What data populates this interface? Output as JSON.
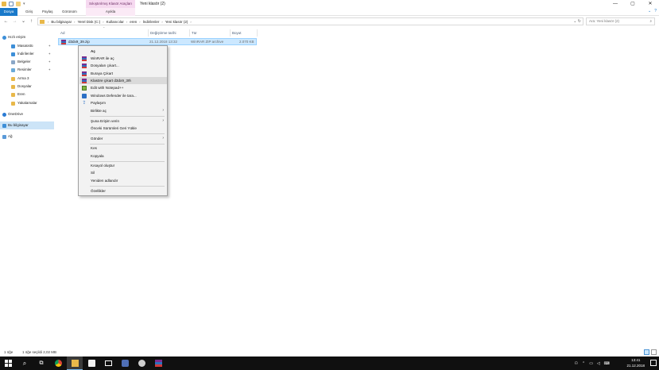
{
  "window": {
    "title": "Yeni klasör (2)",
    "context_tab_header": "Sıkıştırılmış Klasör Araçları",
    "controls": [
      "—",
      "▢",
      "✕"
    ]
  },
  "ribbon": {
    "tabs": [
      "Dosya",
      "Giriş",
      "Paylaş",
      "Görünüm",
      "Ayıkla"
    ]
  },
  "address": {
    "crumbs": [
      "Bu bilgisayar",
      "Yerel Disk (C:)",
      "Kullanıcılar",
      "eren",
      "İndirilenler",
      "Yeni klasör (2)"
    ],
    "search_placeholder": "Ara: Yeni klasör (2)"
  },
  "nav": {
    "quick_access": "Hızlı erişim",
    "items": [
      {
        "label": "Masaüstü",
        "pinned": true,
        "color": "#3d8fd8"
      },
      {
        "label": "İndirilenler",
        "pinned": true,
        "color": "#3d8fd8"
      },
      {
        "label": "Belgeler",
        "pinned": true,
        "color": "#8aa7c7"
      },
      {
        "label": "Resimler",
        "pinned": true,
        "color": "#6aaad8"
      },
      {
        "label": "Arma 3",
        "pinned": false,
        "color": "#e8b84a"
      },
      {
        "label": "Dosyalar",
        "pinned": false,
        "color": "#e8b84a"
      },
      {
        "label": "Eren",
        "pinned": false,
        "color": "#e8b84a"
      },
      {
        "label": "Yakalamalar",
        "pinned": false,
        "color": "#e8b84a"
      }
    ],
    "onedrive": "OneDrive",
    "this_pc": "Bu bilgisayar",
    "network": "Ağ"
  },
  "columns": {
    "name": "Ad",
    "date": "Değiştirme tarihi",
    "type": "Tür",
    "size": "Boyut"
  },
  "files": [
    {
      "name": "d3dx9_39.zip",
      "date": "21.12.2018 13:32",
      "type": "WinRAR ZIP archive",
      "size": "2.070 KB"
    }
  ],
  "context_menu": {
    "items": [
      {
        "label": "Aç",
        "bold": true
      },
      {
        "label": "WinRAR ile aç",
        "icon": "rar"
      },
      {
        "label": "Dosyaları çıkart...",
        "icon": "rar"
      },
      {
        "label": "Buraya Çıkart",
        "icon": "rar"
      },
      {
        "label": "Klasöre çıkart d3dx9_39\\",
        "icon": "rar",
        "highlighted": true
      },
      {
        "label": "Edit with Notepad++",
        "icon": "notepad"
      },
      {
        "label": "Windows Defender ile tara...",
        "icon": "defender"
      },
      {
        "label": "Paylaşım",
        "icon": "share"
      },
      {
        "label": "Birlikte aç",
        "submenu": true
      },
      {
        "label": "Şuna Erişim verin",
        "submenu": true
      },
      {
        "label": "Önceki Sürümleri Geri Yükle"
      },
      {
        "label": "Gönder",
        "submenu": true
      },
      {
        "label": "Kes"
      },
      {
        "label": "Kopyala"
      },
      {
        "label": "Kısayol oluştur"
      },
      {
        "label": "Sil"
      },
      {
        "label": "Yeniden adlandır"
      },
      {
        "label": "Özellikler"
      }
    ]
  },
  "status": {
    "count": "1 öğe",
    "selected": "1 öğe seçildi  2,02 MB"
  },
  "taskbar": {
    "time": "13:41",
    "date": "21.12.2018"
  }
}
